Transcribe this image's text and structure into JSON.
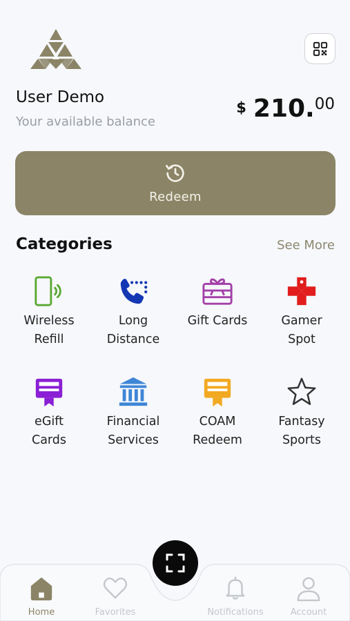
{
  "header": {
    "user_name": "User Demo",
    "balance_label": "Your available balance",
    "balance_currency": "$",
    "balance_integer": "210.",
    "balance_decimal": "00"
  },
  "redeem": {
    "label": "Redeem",
    "icon": "history-icon"
  },
  "categories": {
    "title": "Categories",
    "see_more": "See More",
    "items": [
      {
        "label": "Wireless\nRefill",
        "icon": "phone-wireless-icon",
        "color": "#5aa832"
      },
      {
        "label": "Long\nDistance",
        "icon": "phone-dial-icon",
        "color": "#1437b4"
      },
      {
        "label": "Gift Cards",
        "icon": "gift-card-icon",
        "color": "#a33fa8"
      },
      {
        "label": "Gamer\nSpot",
        "icon": "gamepad-icon",
        "color": "#e11d1d"
      },
      {
        "label": "eGift\nCards",
        "icon": "egift-card-icon",
        "color": "#8a1fd6"
      },
      {
        "label": "Financial\nServices",
        "icon": "bank-icon",
        "color": "#3e86d6"
      },
      {
        "label": "COAM\nRedeem",
        "icon": "coam-card-icon",
        "color": "#f2a922"
      },
      {
        "label": "Fantasy\nSports",
        "icon": "star-icon",
        "color": "#333333"
      }
    ]
  },
  "nav": {
    "items": [
      {
        "label": "Home",
        "icon": "home-icon"
      },
      {
        "label": "Favorites",
        "icon": "heart-icon"
      },
      {
        "label": "Notifications",
        "icon": "bell-icon"
      },
      {
        "label": "Account",
        "icon": "user-icon"
      }
    ],
    "scan_icon": "scan-icon"
  },
  "colors": {
    "accent": "#8b8466",
    "background": "#f6f8fb"
  }
}
